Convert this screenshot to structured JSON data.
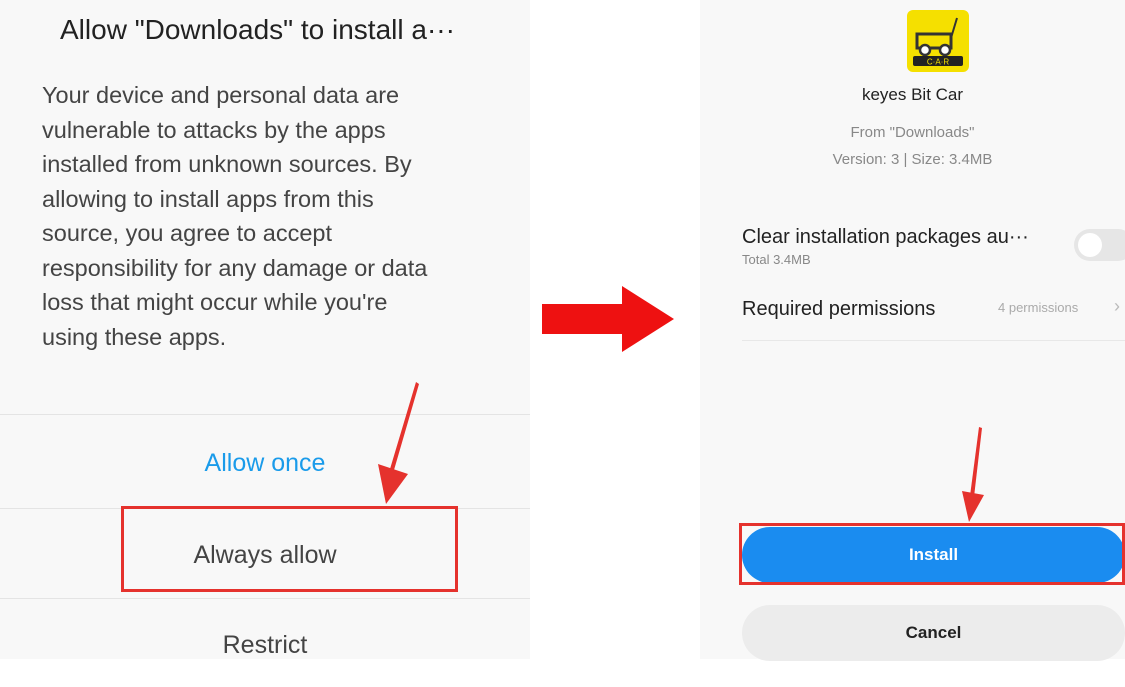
{
  "left_dialog": {
    "title": "Allow \"Downloads\" to install a···",
    "body_lines": [
      "Your device and personal data are",
      "vulnerable to attacks by the apps",
      "installed from unknown sources. By",
      "allowing to install apps from this",
      "source, you agree to accept",
      "responsibility for any damage or data",
      "loss that might occur while you're",
      "using these apps."
    ],
    "allow_once": "Allow once",
    "always_allow": "Always allow",
    "restrict": "Restrict"
  },
  "install_screen": {
    "app_icon_text": "C·A·R",
    "app_name": "keyes Bit Car",
    "source": "From \"Downloads\"",
    "version_size": "Version: 3 | Size: 3.4MB",
    "clear_packages_title": "Clear installation packages au···",
    "clear_packages_sub": "Total 3.4MB",
    "clear_packages_enabled": false,
    "permissions_title": "Required permissions",
    "permissions_count": "4 permissions",
    "install_label": "Install",
    "cancel_label": "Cancel"
  },
  "colors": {
    "highlight": "#e5322d",
    "accent_blue": "#1a8cf0",
    "link_blue": "#1a9bea"
  }
}
